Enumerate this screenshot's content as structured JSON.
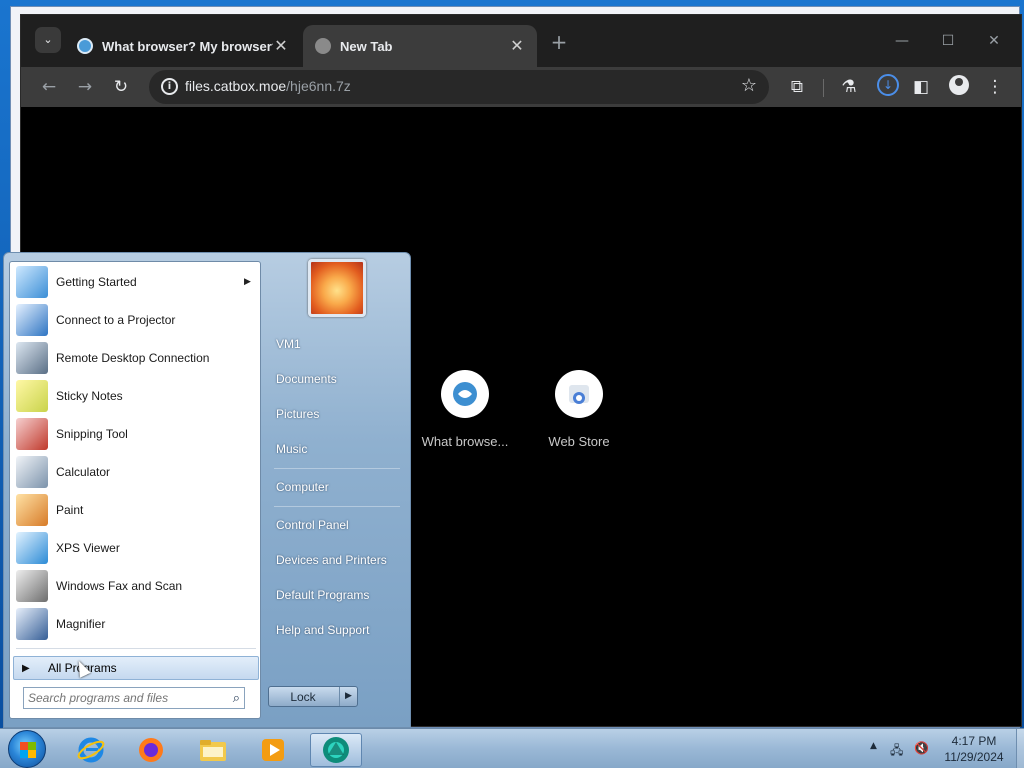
{
  "browser": {
    "tabs": [
      {
        "title": "What browser? My browser? Is",
        "favicon": "catbox-icon"
      },
      {
        "title": "New Tab",
        "favicon": "newtab-icon"
      }
    ],
    "new_tab_label": "+",
    "address": {
      "host": "files.catbox.moe",
      "path": "/hje6nn.7z"
    },
    "shortcuts": [
      {
        "label": "What browse...",
        "icon": "catbox-icon"
      },
      {
        "label": "Web Store",
        "icon": "web-store-icon"
      }
    ]
  },
  "start_menu": {
    "programs": [
      {
        "label": "Getting Started",
        "icon": "getting-started-icon",
        "submenu": true
      },
      {
        "label": "Connect to a Projector",
        "icon": "projector-icon",
        "submenu": false
      },
      {
        "label": "Remote Desktop Connection",
        "icon": "remote-desktop-icon",
        "submenu": false
      },
      {
        "label": "Sticky Notes",
        "icon": "sticky-notes-icon",
        "submenu": false
      },
      {
        "label": "Snipping Tool",
        "icon": "snipping-tool-icon",
        "submenu": false
      },
      {
        "label": "Calculator",
        "icon": "calculator-icon",
        "submenu": false
      },
      {
        "label": "Paint",
        "icon": "paint-icon",
        "submenu": false
      },
      {
        "label": "XPS Viewer",
        "icon": "xps-viewer-icon",
        "submenu": false
      },
      {
        "label": "Windows Fax and Scan",
        "icon": "fax-scan-icon",
        "submenu": false
      },
      {
        "label": "Magnifier",
        "icon": "magnifier-icon",
        "submenu": false
      }
    ],
    "all_programs": "All Programs",
    "search_placeholder": "Search programs and files",
    "places": [
      "VM1",
      "Documents",
      "Pictures",
      "Music",
      "Computer",
      "Control Panel",
      "Devices and Printers",
      "Default Programs",
      "Help and Support"
    ],
    "lock_label": "Lock"
  },
  "taskbar": {
    "pinned": [
      "internet-explorer-icon",
      "firefox-icon",
      "file-explorer-icon",
      "media-player-icon",
      "browser-app-icon"
    ],
    "clock": {
      "time": "4:17 PM",
      "date": "11/29/2024"
    }
  },
  "colors": {
    "accent": "#4b8ee8",
    "tab_bg": "#1f1f1f",
    "toolbar_bg": "#3c3c3c"
  }
}
